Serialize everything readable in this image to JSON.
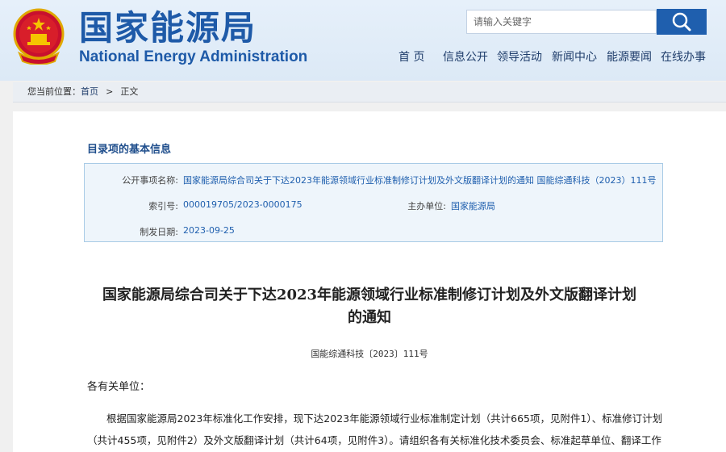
{
  "header": {
    "title_cn": "国家能源局",
    "title_en": "National Energy Administration",
    "emblem_icon": "national-emblem-icon"
  },
  "search": {
    "placeholder": "请输入关键字",
    "icon": "search-icon"
  },
  "nav": {
    "items": [
      "首 页",
      "信息公开",
      "领导活动",
      "新闻中心",
      "能源要闻",
      "在线办事"
    ]
  },
  "breadcrumb": {
    "prefix": "您当前位置：",
    "home": "首页",
    "separator": ">",
    "current": "正文"
  },
  "catalog": {
    "section_title": "目录项的基本信息",
    "subject_label": "公开事项名称:",
    "subject_value": "国家能源局综合司关于下达2023年能源领域行业标准制修订计划及外文版翻译计划的通知 国能综通科技（2023）111号",
    "index_label": "索引号:",
    "index_value": "000019705/2023-0000175",
    "org_label": "主办单位:",
    "org_value": "国家能源局",
    "date_label": "制发日期:",
    "date_value": "2023-09-25"
  },
  "article": {
    "title_line1": "国家能源局综合司关于下达2023年能源领域行业标准制修订计划及外文版翻译计划",
    "title_line2": "的通知",
    "doc_number": "国能综通科技〔2023〕111号",
    "salutation": "各有关单位：",
    "para1_line1": "根据国家能源局2023年标准化工作安排，现下达2023年能源领域行业标准制定计划（共计665项，见附件1）、标准修订计划",
    "para1_line2": "（共计455项，见附件2）及外文版翻译计划（共计64项，见附件3）。请组织各有关标准化技术委员会、标准起草单位、翻译工作"
  },
  "colors": {
    "brand_blue": "#1e5aa8",
    "link_blue": "#1f5fae",
    "search_button": "#1f5fae",
    "header_bg": "#e6f0fa",
    "info_box_bg": "#eef5fb"
  }
}
